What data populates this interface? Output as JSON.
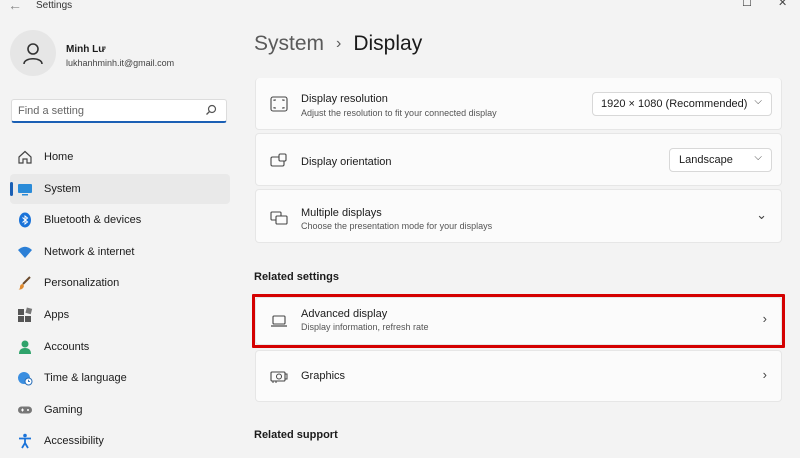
{
  "window": {
    "title": "Settings",
    "back_glyph": "←",
    "minimize_glyph": "—",
    "maximize_glyph": "☐",
    "close_glyph": "✕"
  },
  "user": {
    "name": "Minh Lư",
    "email": "lukhanhminh.it@gmail.com"
  },
  "search": {
    "placeholder": "Find a setting"
  },
  "nav": {
    "items": [
      {
        "label": "Home",
        "icon": "home-icon"
      },
      {
        "label": "System",
        "icon": "system-icon",
        "active": true
      },
      {
        "label": "Bluetooth & devices",
        "icon": "bluetooth-icon"
      },
      {
        "label": "Network & internet",
        "icon": "wifi-icon"
      },
      {
        "label": "Personalization",
        "icon": "brush-icon"
      },
      {
        "label": "Apps",
        "icon": "apps-icon"
      },
      {
        "label": "Accounts",
        "icon": "accounts-icon"
      },
      {
        "label": "Time & language",
        "icon": "globe-clock-icon"
      },
      {
        "label": "Gaming",
        "icon": "gamepad-icon"
      },
      {
        "label": "Accessibility",
        "icon": "accessibility-icon"
      }
    ]
  },
  "breadcrumb": {
    "parent": "System",
    "separator": "›",
    "current": "Display"
  },
  "settings": {
    "resolution": {
      "title": "Display resolution",
      "subtitle": "Adjust the resolution to fit your connected display",
      "value": "1920 × 1080 (Recommended)"
    },
    "orientation": {
      "title": "Display orientation",
      "value": "Landscape"
    },
    "multiple": {
      "title": "Multiple displays",
      "subtitle": "Choose the presentation mode for your displays"
    }
  },
  "related": {
    "heading": "Related settings",
    "advanced": {
      "title": "Advanced display",
      "subtitle": "Display information, refresh rate"
    },
    "graphics": {
      "title": "Graphics"
    }
  },
  "support": {
    "heading": "Related support"
  },
  "glyphs": {
    "chevron_right": "›",
    "chevron_down": "⌄",
    "dropdown_arrow": "⌵"
  },
  "colors": {
    "accent": "#1a5fb4",
    "highlight": "#d40000"
  }
}
